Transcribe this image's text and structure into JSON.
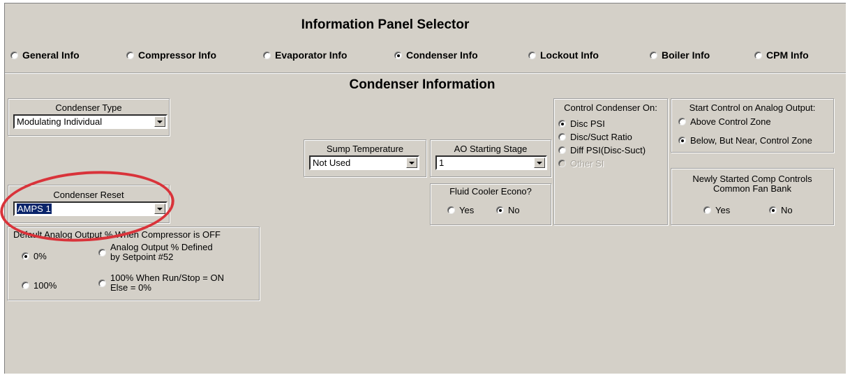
{
  "selector": {
    "title": "Information Panel Selector",
    "options": [
      {
        "label": "General Info",
        "checked": false
      },
      {
        "label": "Compressor Info",
        "checked": false
      },
      {
        "label": "Evaporator Info",
        "checked": false
      },
      {
        "label": "Condenser Info",
        "checked": true
      },
      {
        "label": "Lockout Info",
        "checked": false
      },
      {
        "label": "Boiler Info",
        "checked": false
      },
      {
        "label": "CPM Info",
        "checked": false
      }
    ]
  },
  "condenser": {
    "title": "Condenser Information",
    "type": {
      "label": "Condenser Type",
      "value": "Modulating Individual"
    },
    "reset": {
      "label": "Condenser Reset",
      "value": "AMPS 1"
    },
    "sump": {
      "label": "Sump Temperature",
      "value": "Not Used"
    },
    "ao_stage": {
      "label": "AO Starting Stage",
      "value": "1"
    },
    "fluid_cooler": {
      "label": "Fluid Cooler Econo?",
      "yes": "Yes",
      "no": "No",
      "selected": "No"
    },
    "control_on": {
      "label": "Control Condenser On:",
      "options": [
        {
          "label": "Disc PSI",
          "checked": true,
          "disabled": false
        },
        {
          "label": "Disc/Suct Ratio",
          "checked": false,
          "disabled": false
        },
        {
          "label": "Diff PSI(Disc-Suct)",
          "checked": false,
          "disabled": false
        },
        {
          "label": "Other SI",
          "checked": false,
          "disabled": true
        }
      ]
    },
    "start_control": {
      "label": "Start Control on Analog Output:",
      "options": [
        {
          "label": "Above Control Zone",
          "checked": false
        },
        {
          "label": "Below, But Near, Control Zone",
          "checked": true
        }
      ]
    },
    "newly_started": {
      "line1": "Newly Started Comp Controls",
      "line2": "Common Fan Bank",
      "yes": "Yes",
      "no": "No",
      "selected": "No"
    },
    "default_ao": {
      "label": "Default Analog Output % When Compressor is OFF",
      "opt_0": "0%",
      "opt_100": "100%",
      "opt_defined_1": "Analog Output % Defined",
      "opt_defined_2": "by Setpoint #52",
      "opt_run_1": "100% When Run/Stop = ON",
      "opt_run_2": "Else = 0%",
      "selected": "0%"
    }
  },
  "annotation_color": "#d9333a"
}
